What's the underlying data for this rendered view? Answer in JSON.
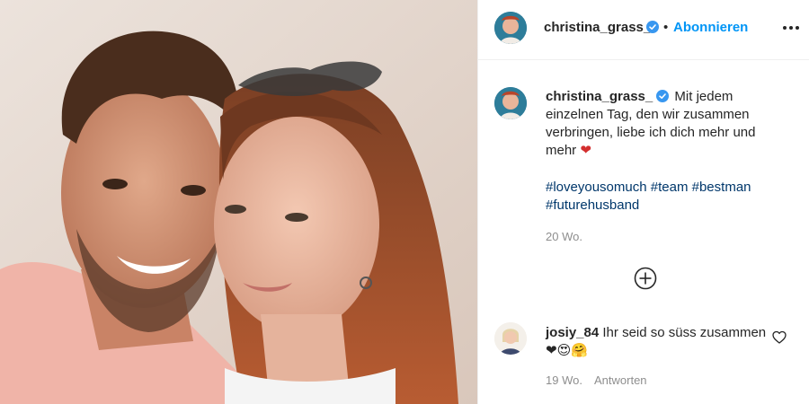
{
  "post": {
    "photo_alt": "Selfie of couple",
    "username": "christina_grass_",
    "follow_label": "Abonnieren",
    "dot": "•",
    "caption": {
      "text": "Mit jedem einzelnen Tag, den wir zusammen verbringen, liebe ich dich mehr und mehr",
      "heart": "❤",
      "hashtags": [
        "#loveyousomuch",
        "#team",
        "#bestman",
        "#futurehusband"
      ],
      "time": "20 Wo."
    },
    "comment": {
      "username": "josiy_84",
      "text": "Ihr seid so süss zusammen",
      "emoji": "❤😍🤗",
      "time": "19 Wo.",
      "reply_label": "Antworten"
    }
  },
  "colors": {
    "accent": "#0095f6",
    "hashtag": "#00376b",
    "muted": "#8e8e8e",
    "text": "#262626",
    "verified": "#3897f0"
  },
  "icons": {
    "verified": "verified-badge-icon",
    "more": "more-options-icon",
    "load_more": "plus-circle-icon",
    "like": "heart-outline-icon"
  }
}
